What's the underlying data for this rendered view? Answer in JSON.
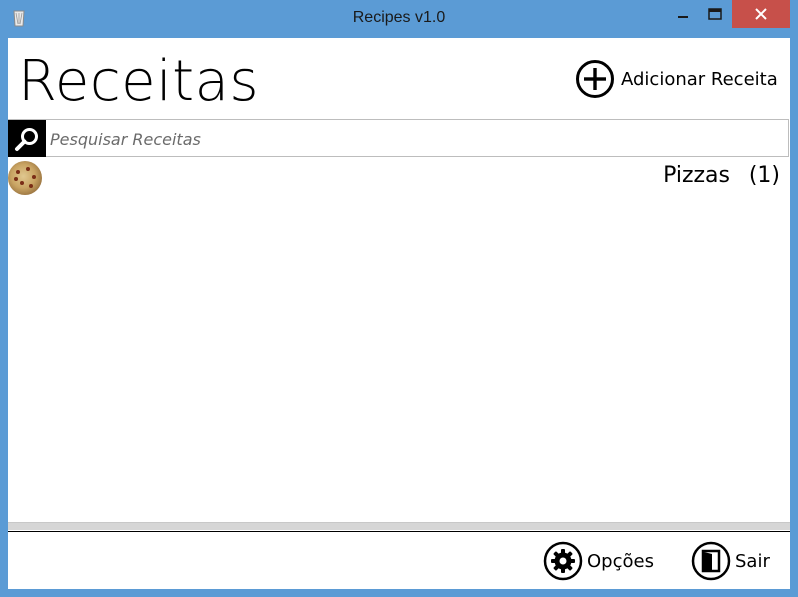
{
  "window": {
    "title": "Recipes v1.0",
    "accent": "#5b9bd5",
    "close_color": "#c7504a"
  },
  "header": {
    "title": "Receitas",
    "add_button_label": "Adicionar Receita",
    "add_icon": "plus-circle-icon"
  },
  "search": {
    "placeholder": "Pesquisar Receitas",
    "value": "",
    "icon": "search-icon"
  },
  "categories": [
    {
      "name": "Pizzas",
      "count": "(1)",
      "icon": "pizza-thumbnail"
    }
  ],
  "footer": {
    "options_label": "Opções",
    "options_icon": "gear-icon",
    "exit_label": "Sair",
    "exit_icon": "door-exit-icon"
  }
}
